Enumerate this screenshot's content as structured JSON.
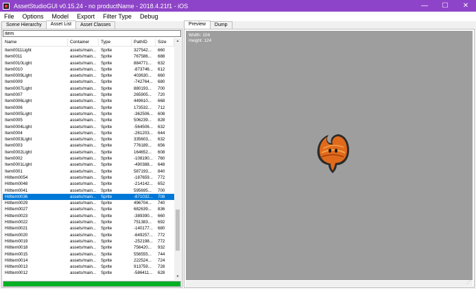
{
  "window": {
    "title": "AssetStudioGUI v0.15.24 - no productName - 2018.4.21f1 - iOS",
    "minimize": "—",
    "maximize": "☐",
    "close": "✕"
  },
  "menu": [
    "File",
    "Options",
    "Model",
    "Export",
    "Filter Type",
    "Debug"
  ],
  "left_tabs": [
    "Scene Hierarchy",
    "Asset List",
    "Asset Classes"
  ],
  "active_left_tab": "Asset List",
  "filter": {
    "value": "item"
  },
  "columns": [
    "Name",
    "Container",
    "Type",
    "PathID",
    "Size"
  ],
  "rows": [
    [
      "Item0011Light",
      "assets/main...",
      "Sprite",
      "327542...",
      "660"
    ],
    [
      "Item0011",
      "assets/main...",
      "Sprite",
      "767586...",
      "688"
    ],
    [
      "Item0010Light",
      "assets/main...",
      "Sprite",
      "884771...",
      "632"
    ],
    [
      "Item0010",
      "assets/main...",
      "Sprite",
      "-873746...",
      "612"
    ],
    [
      "Item0009Light",
      "assets/main...",
      "Sprite",
      "403630...",
      "660"
    ],
    [
      "Item0009",
      "assets/main...",
      "Sprite",
      "-742764...",
      "680"
    ],
    [
      "Item0007Light",
      "assets/main...",
      "Sprite",
      "880193...",
      "700"
    ],
    [
      "Item0007",
      "assets/main...",
      "Sprite",
      "265905...",
      "720"
    ],
    [
      "Item0006Light",
      "assets/main...",
      "Sprite",
      "449610...",
      "668"
    ],
    [
      "Item0006",
      "assets/main...",
      "Sprite",
      "173532...",
      "712"
    ],
    [
      "Item0005Light",
      "assets/main...",
      "Sprite",
      "-362506...",
      "608"
    ],
    [
      "Item0005",
      "assets/main...",
      "Sprite",
      "506239...",
      "828"
    ],
    [
      "Item0004Light",
      "assets/main...",
      "Sprite",
      "-564506...",
      "632"
    ],
    [
      "Item0004",
      "assets/main...",
      "Sprite",
      "-261203...",
      "644"
    ],
    [
      "Item0003Light",
      "assets/main...",
      "Sprite",
      "335603...",
      "632"
    ],
    [
      "Item0003",
      "assets/main...",
      "Sprite",
      "776189...",
      "656"
    ],
    [
      "Item0002Light",
      "assets/main...",
      "Sprite",
      "164652...",
      "608"
    ],
    [
      "Item0002",
      "assets/main...",
      "Sprite",
      "-108190...",
      "760"
    ],
    [
      "Item0001Light",
      "assets/main...",
      "Sprite",
      "-490388...",
      "648"
    ],
    [
      "Item0001",
      "assets/main...",
      "Sprite",
      "587193...",
      "840"
    ],
    [
      "HitItem0054",
      "assets/main...",
      "Sprite",
      "-187659...",
      "772"
    ],
    [
      "HitItem0048",
      "assets/main...",
      "Sprite",
      "-214142...",
      "652"
    ],
    [
      "HitItem0041",
      "assets/main...",
      "Sprite",
      "595695...",
      "700"
    ],
    [
      "HitItem0036",
      "assets/main...",
      "Sprite",
      "-871032...",
      "708"
    ],
    [
      "HitItem0029",
      "assets/main...",
      "Sprite",
      "496704...",
      "740"
    ],
    [
      "HitItem0027",
      "assets/main...",
      "Sprite",
      "682639...",
      "836"
    ],
    [
      "HitItem0023",
      "assets/main...",
      "Sprite",
      "-389390...",
      "660"
    ],
    [
      "HitItem0022",
      "assets/main...",
      "Sprite",
      "751383...",
      "692"
    ],
    [
      "HitItem0021",
      "assets/main...",
      "Sprite",
      "-140177...",
      "680"
    ],
    [
      "HitItem0020",
      "assets/main...",
      "Sprite",
      "-649257...",
      "772"
    ],
    [
      "HitItem0019",
      "assets/main...",
      "Sprite",
      "-252198...",
      "772"
    ],
    [
      "HitItem0018",
      "assets/main...",
      "Sprite",
      "756420...",
      "932"
    ],
    [
      "HitItem0015",
      "assets/main...",
      "Sprite",
      "556555...",
      "744"
    ],
    [
      "HitItem0014",
      "assets/main...",
      "Sprite",
      "222524...",
      "724"
    ],
    [
      "HitItem0013",
      "assets/main...",
      "Sprite",
      "913759...",
      "728"
    ],
    [
      "HitItem0012",
      "assets/main...",
      "Sprite",
      "-586411...",
      "628"
    ]
  ],
  "selected_row": 23,
  "progress": {
    "value": 1.0,
    "color": "#06b025"
  },
  "right_tabs": [
    "Preview",
    "Dump"
  ],
  "active_right_tab": "Preview",
  "preview_info": {
    "width": "Width: 104",
    "height": "Height: 124"
  },
  "preview_sprite": {
    "icon": "leaf-item-icon",
    "color": "#e06a1c"
  },
  "colors": {
    "titlebar": "#8e44c8",
    "selection": "#0078d7",
    "preview_bg": "#9e9e9e"
  }
}
